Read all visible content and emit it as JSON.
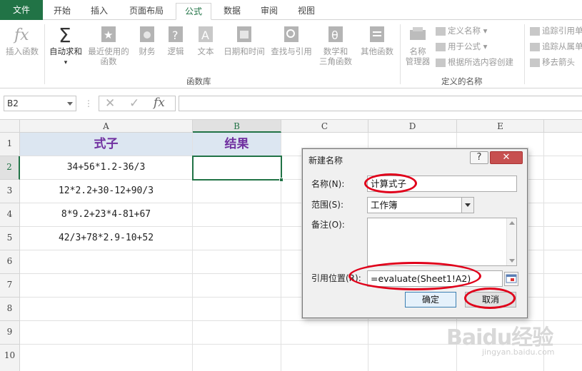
{
  "tabs": [
    "文件",
    "开始",
    "插入",
    "页面布局",
    "公式",
    "数据",
    "审阅",
    "视图"
  ],
  "ribbon": {
    "insert_function": "插入函数",
    "autosum": "自动求和",
    "recent_line1": "最近使用的",
    "recent_line2": "函数",
    "finance": "财务",
    "logical": "逻辑",
    "text": "文本",
    "datetime": "日期和时间",
    "lookup": "查找与引用",
    "math_line1": "数学和",
    "math_line2": "三角函数",
    "other": "其他函数",
    "function_library": "函数库",
    "name_mgr_line1": "名称",
    "name_mgr_line2": "管理器",
    "define_name": "定义名称",
    "use_in_formula": "用于公式",
    "create_from_sel": "根据所选内容创建",
    "defined_names": "定义的名称",
    "trace_precedents": "追踪引用单",
    "trace_dependents": "追踪从属单",
    "remove_arrows": "移去箭头"
  },
  "formula_bar": {
    "name_box": "B2",
    "cancel_glyph": "✕",
    "enter_glyph": "✓",
    "fx_glyph": "fx"
  },
  "grid": {
    "columns": [
      "A",
      "B",
      "C",
      "D",
      "E"
    ],
    "rows": [
      "1",
      "2",
      "3",
      "4",
      "5",
      "6",
      "7",
      "8",
      "9",
      "10"
    ],
    "header_a": "式子",
    "header_b": "结果",
    "formulas": [
      "34+56*1.2-36/3",
      "12*2.2+30-12+90/3",
      "8*9.2+23*4-81+67",
      "42/3+78*2.9-10+52"
    ]
  },
  "dialog": {
    "title": "新建名称",
    "help_glyph": "?",
    "close_glyph": "✕",
    "name_label": "名称(N):",
    "name_value": "计算式子",
    "scope_label": "范围(S):",
    "scope_value": "工作簿",
    "comment_label": "备注(O):",
    "ref_label": "引用位置(R):",
    "ref_value": "=evaluate(Sheet1!A2)",
    "ok": "确定",
    "cancel": "取消"
  },
  "watermark": {
    "brand": "Baidu经验",
    "url": "jingyan.baidu.com"
  },
  "colors": {
    "excel_green": "#217346",
    "header_purple": "#7030a0",
    "header_fill": "#dce6f1",
    "annotation_red": "#e0001a"
  }
}
